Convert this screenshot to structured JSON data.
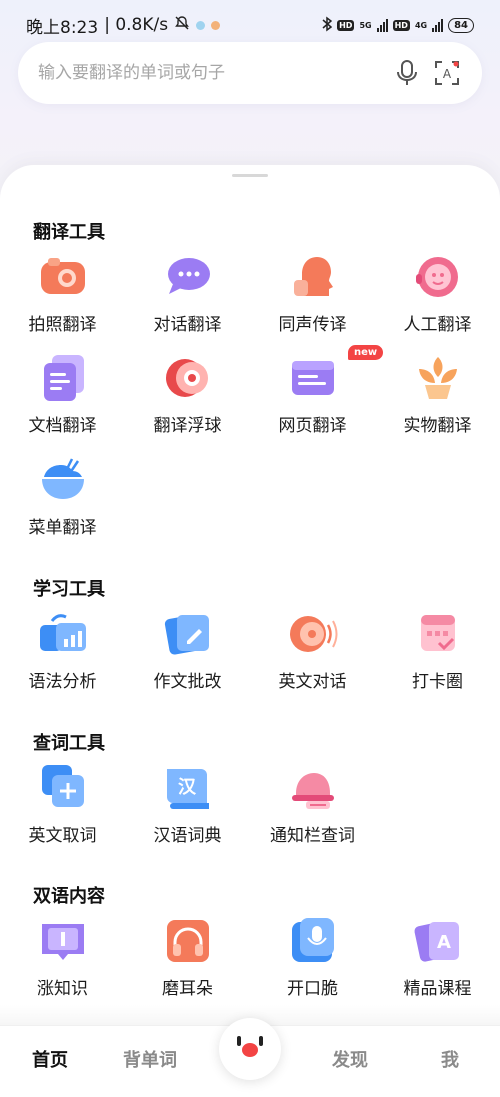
{
  "status_bar": {
    "time": "晚上8:23",
    "speed": "| 0.8K/s",
    "net1": "5G",
    "net2": "4G",
    "hd": "HD",
    "battery": "84"
  },
  "search": {
    "placeholder": "输入要翻译的单词或句子"
  },
  "sections": {
    "translate_tools": {
      "title": "翻译工具",
      "items": [
        "拍照翻译",
        "对话翻译",
        "同声传译",
        "人工翻译",
        "文档翻译",
        "翻译浮球",
        "网页翻译",
        "实物翻译",
        "菜单翻译"
      ],
      "new_badge": "new"
    },
    "study_tools": {
      "title": "学习工具",
      "items": [
        "语法分析",
        "作文批改",
        "英文对话",
        "打卡圈"
      ]
    },
    "lookup_tools": {
      "title": "查词工具",
      "items": [
        "英文取词",
        "汉语词典",
        "通知栏查词"
      ],
      "dict_glyph": "汉"
    },
    "bilingual": {
      "title": "双语内容",
      "items": [
        "涨知识",
        "磨耳朵",
        "开口脆",
        "精品课程"
      ],
      "course_glyph": "A"
    }
  },
  "bottom_nav": {
    "home": "首页",
    "words": "背单词",
    "discover": "发现",
    "me": "我"
  },
  "colors": {
    "accent_red": "#f34444",
    "orange": "#f47a5a",
    "purple": "#9b7cf3",
    "blue": "#3d8ef5"
  }
}
